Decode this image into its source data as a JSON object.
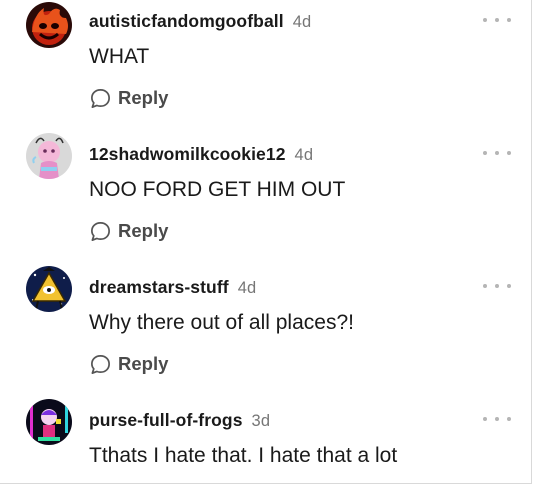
{
  "comments": [
    {
      "username": "autisticfandomgoofball",
      "time": "4d",
      "text": "WHAT",
      "reply_label": "Reply",
      "avatar_icon": "flame-face-avatar",
      "more_icon": "more-options-icon"
    },
    {
      "username": "12shadwomilkcookie12",
      "time": "4d",
      "text": "NOO FORD GET HIM OUT",
      "reply_label": "Reply",
      "avatar_icon": "pink-character-avatar",
      "more_icon": "more-options-icon"
    },
    {
      "username": "dreamstars-stuff",
      "time": "4d",
      "text": "Why there out of all places?!",
      "reply_label": "Reply",
      "avatar_icon": "triangle-eye-avatar",
      "more_icon": "more-options-icon"
    },
    {
      "username": "purse-full-of-frogs",
      "time": "3d",
      "text": "Tthats I hate that. I hate that a lot",
      "avatar_icon": "neon-character-avatar",
      "more_icon": "more-options-icon"
    }
  ],
  "colors": {
    "text": "#1a1a1a",
    "muted": "#767676",
    "reply": "#4a4a4a",
    "dots": "#b5b5b5"
  }
}
